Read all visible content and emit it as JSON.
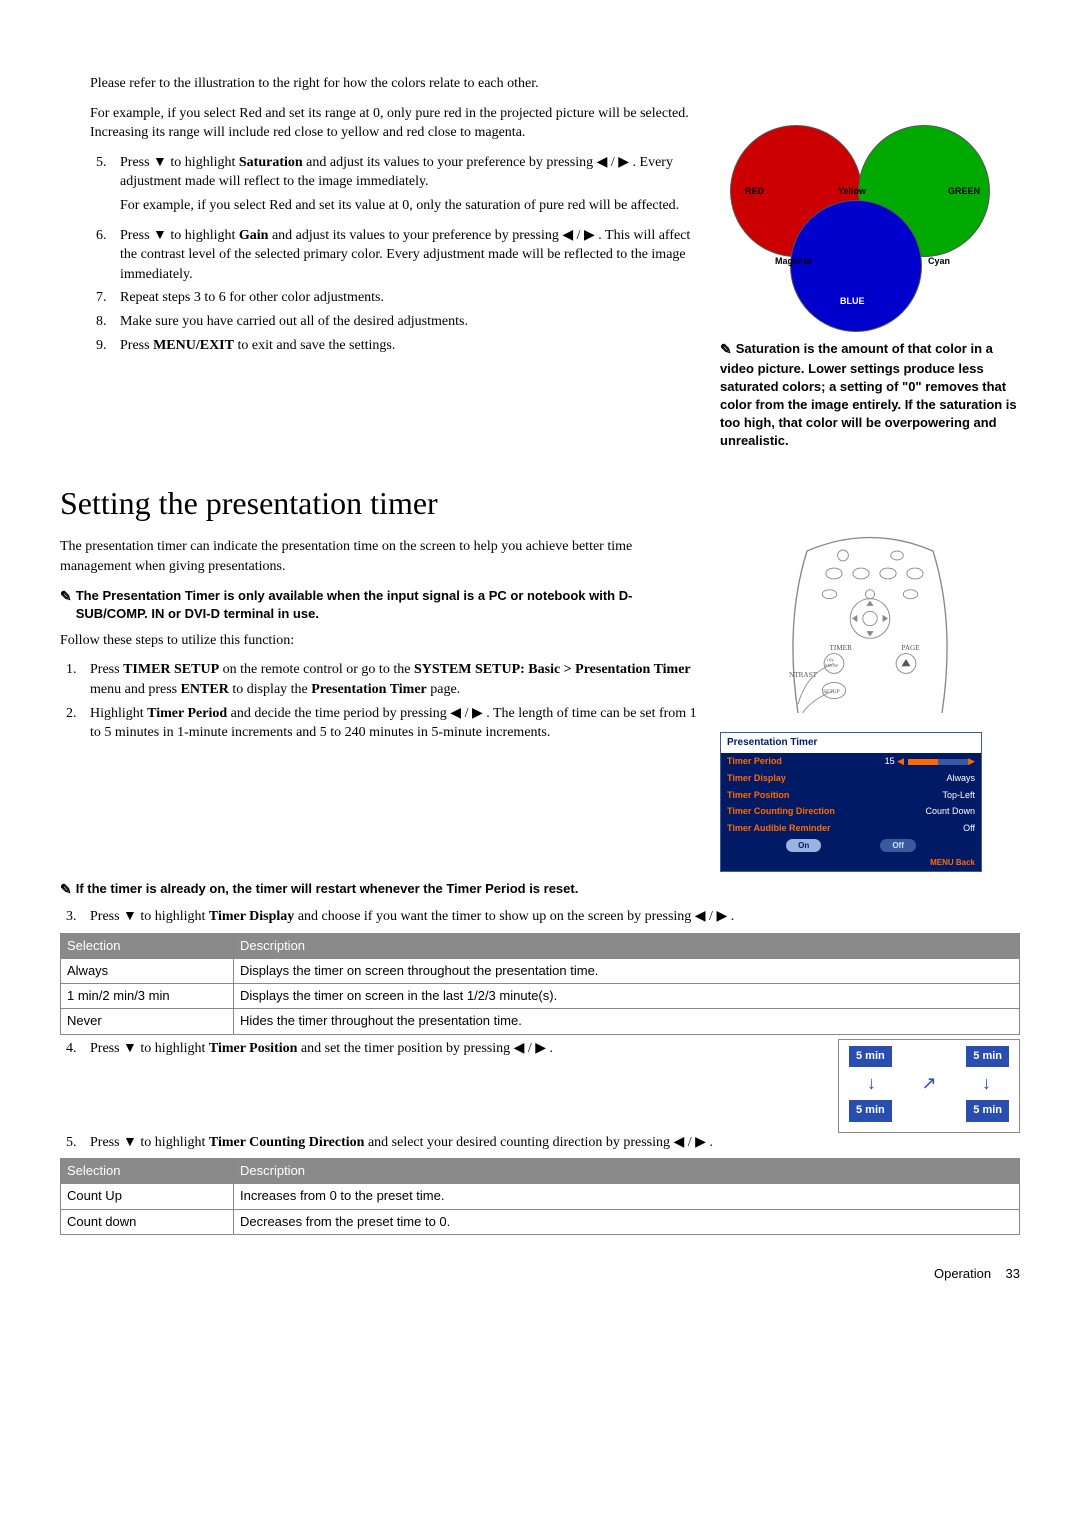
{
  "top": {
    "intro1": "Please refer to the illustration to the right for how the colors relate to each other.",
    "intro2": "For example, if you select Red and set its range at 0, only pure red in the projected picture will be selected. Increasing its range will include red close to yellow and red close to magenta.",
    "step5a": "Press ▼ to highlight ",
    "step5b": "Saturation",
    "step5c": " and adjust its values to your preference by pressing ◀ / ▶ . Every adjustment made will reflect to the image immediately.",
    "step5d": "For example, if you select Red and set its value at 0, only the saturation of pure red will be affected.",
    "step6a": "Press ▼ to highlight ",
    "step6b": "Gain",
    "step6c": " and adjust its values to your preference by pressing ◀ / ▶ . This will affect the contrast level of the selected primary color. Every adjustment made will be reflected to the image immediately.",
    "step7": "Repeat steps 3 to 6 for other color adjustments.",
    "step8": "Make sure you have carried out all of the desired adjustments.",
    "step9a": "Press ",
    "step9b": "MENU/EXIT",
    "step9c": " to exit and save the settings."
  },
  "venn": {
    "red": "RED",
    "green": "GREEN",
    "blue": "BLUE",
    "yellow": "Yellow",
    "magenta": "Magenta",
    "cyan": "Cyan"
  },
  "saturation_note": "Saturation is the amount of that color in a video picture. Lower settings produce less saturated colors; a setting of \"0\" removes that color from the image entirely. If the saturation is too high, that color will be overpowering and unrealistic.",
  "h1": "Setting the presentation timer",
  "timer": {
    "intro": "The presentation timer can indicate the presentation time on the screen to help you achieve better time management when giving presentations.",
    "note1": "The Presentation Timer is only available when the input signal is a PC or notebook with D-SUB/COMP. IN or DVI-D terminal in use.",
    "follow": "Follow these steps to utilize this function:",
    "s1a": "Press ",
    "s1b": "TIMER SETUP",
    "s1c": " on the remote control or go to the ",
    "s1d": "SYSTEM SETUP: Basic > Presentation Timer",
    "s1e": " menu and press ",
    "s1f": "ENTER",
    "s1g": " to display the ",
    "s1h": "Presentation Timer",
    "s1i": " page.",
    "s2a": "Highlight ",
    "s2b": "Timer Period",
    "s2c": " and decide the time period by pressing ◀ / ▶ . The length of time can be set from 1 to 5 minutes in 1-minute increments and 5 to 240 minutes in 5-minute increments.",
    "note2": "If the timer is already on, the timer will restart whenever the Timer Period is reset.",
    "s3a": "Press ▼ to highlight ",
    "s3b": "Timer Display",
    "s3c": " and choose if you want the timer to show up on the screen by pressing ◀ / ▶ .",
    "s4a": "Press ▼ to highlight ",
    "s4b": "Timer Position",
    "s4c": " and set the timer position by pressing ◀ / ▶ .",
    "s5a": "Press ▼ to highlight ",
    "s5b": "Timer Counting Direction",
    "s5c": " and select your desired counting direction by pressing ◀ / ▶ ."
  },
  "osd": {
    "title": "Presentation Timer",
    "rows": [
      {
        "k": "Timer Period",
        "v": "15"
      },
      {
        "k": "Timer Display",
        "v": "Always"
      },
      {
        "k": "Timer Position",
        "v": "Top-Left"
      },
      {
        "k": "Timer Counting Direction",
        "v": "Count Down"
      },
      {
        "k": "Timer Audible Reminder",
        "v": "Off"
      }
    ],
    "on": "On",
    "off": "Off",
    "menuback": "MENU Back"
  },
  "remote_labels": {
    "timer": "TIMER",
    "page": "PAGE",
    "onshow": "ON/\nSHOW",
    "setup": "SETUP",
    "ntrast": "NTRAST"
  },
  "table1": {
    "h1": "Selection",
    "h2": "Description",
    "rows": [
      {
        "s": "Always",
        "d": "Displays the timer on screen throughout the presentation time."
      },
      {
        "s": "1 min/2 min/3 min",
        "d": "Displays the timer on screen in the last 1/2/3 minute(s)."
      },
      {
        "s": "Never",
        "d": "Hides the timer throughout the presentation time."
      }
    ]
  },
  "pos_badge": "5 min",
  "table2": {
    "h1": "Selection",
    "h2": "Description",
    "rows": [
      {
        "s": "Count Up",
        "d": "Increases from 0 to the preset time."
      },
      {
        "s": "Count down",
        "d": "Decreases from the preset time to 0."
      }
    ]
  },
  "footer": {
    "label": "Operation",
    "page": "33"
  }
}
